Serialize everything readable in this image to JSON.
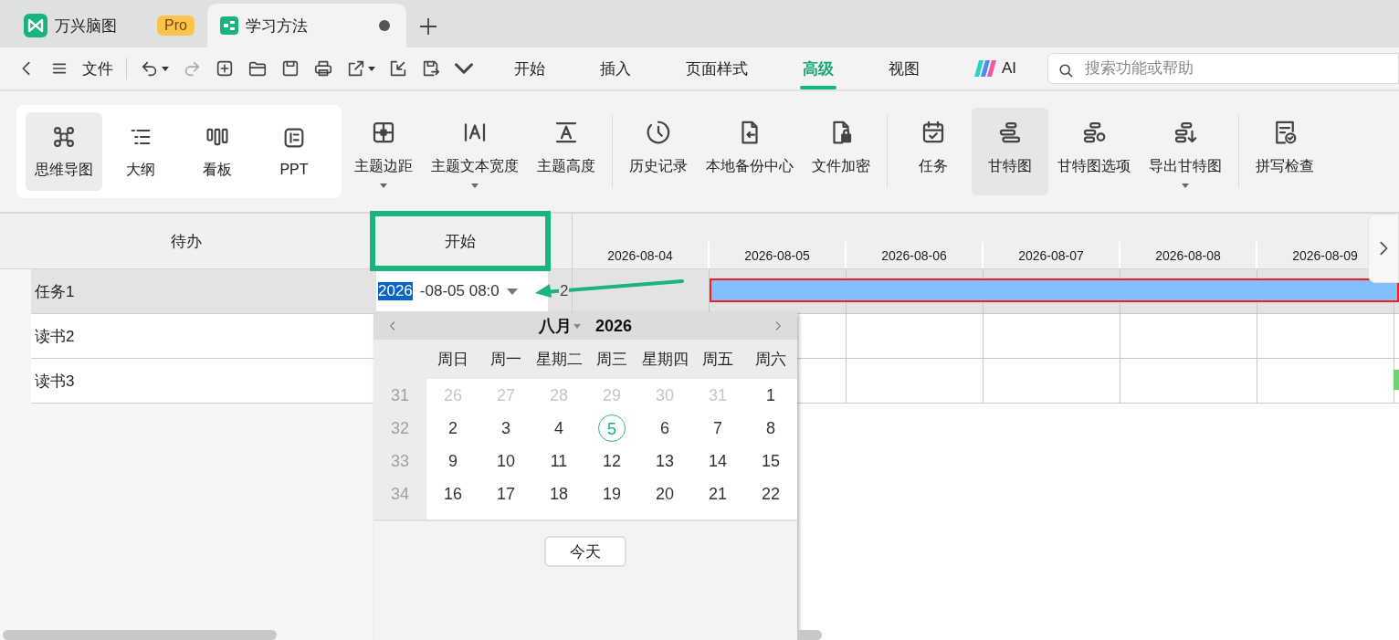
{
  "tabs": [
    {
      "kind": "app",
      "label": "万兴脑图",
      "badge": "Pro",
      "selected": false
    },
    {
      "kind": "document",
      "label": "学习方法",
      "unsaved": true,
      "selected": true
    }
  ],
  "quick_bar": {
    "file_label": "文件",
    "actions": [
      {
        "disabled": false,
        "dropdown": true
      },
      {
        "disabled": true,
        "dropdown": false
      },
      {
        "disabled": false,
        "dropdown": false
      },
      {
        "disabled": false,
        "dropdown": false
      },
      {
        "disabled": false,
        "dropdown": false
      },
      {
        "disabled": false,
        "dropdown": false
      },
      {
        "disabled": false,
        "dropdown": true
      },
      {
        "disabled": false,
        "dropdown": false
      },
      {
        "disabled": false,
        "dropdown": false
      },
      {
        "disabled": false,
        "dropdown": false
      }
    ]
  },
  "menu": [
    {
      "kind": "text",
      "label": "开始",
      "selected": false
    },
    {
      "kind": "text",
      "label": "插入",
      "selected": false
    },
    {
      "kind": "text",
      "label": "页面样式",
      "selected": false
    },
    {
      "kind": "text",
      "label": "高级",
      "selected": true
    },
    {
      "kind": "text",
      "label": "视图",
      "selected": false
    },
    {
      "kind": "ai",
      "label": "AI",
      "selected": false
    }
  ],
  "search": {
    "placeholder": "搜索功能或帮助"
  },
  "view_modes": [
    {
      "label": "思维导图",
      "selected": true
    },
    {
      "label": "大纲",
      "selected": false
    },
    {
      "label": "看板",
      "selected": false
    },
    {
      "label": "PPT",
      "selected": false
    }
  ],
  "ribbon_groups": [
    [
      {
        "label": "主题边距",
        "dropdown": true,
        "selected": false
      },
      {
        "label": "主题文本宽度",
        "dropdown": true,
        "selected": false
      },
      {
        "label": "主题高度",
        "dropdown": false,
        "selected": false
      }
    ],
    [
      {
        "label": "历史记录",
        "dropdown": false,
        "selected": false
      },
      {
        "label": "本地备份中心",
        "dropdown": false,
        "selected": false
      },
      {
        "label": "文件加密",
        "dropdown": false,
        "selected": false
      }
    ],
    [
      {
        "label": "任务",
        "dropdown": false,
        "selected": false
      },
      {
        "label": "甘特图",
        "dropdown": false,
        "selected": true
      },
      {
        "label": "甘特图选项",
        "dropdown": false,
        "selected": false
      },
      {
        "label": "导出甘特图",
        "dropdown": true,
        "selected": false
      }
    ],
    [
      {
        "label": "拼写检查",
        "dropdown": false,
        "selected": false
      }
    ]
  ],
  "gantt": {
    "columns": [
      {
        "label": "待办",
        "highlighted": false
      },
      {
        "label": "开始",
        "highlighted": true
      }
    ],
    "annotation_arrow": true,
    "timeline_dates": [
      "2026-08-04",
      "2026-08-05",
      "2026-08-06",
      "2026-08-07",
      "2026-08-08",
      "2026-08-09"
    ],
    "rows": [
      {
        "name": "任务1",
        "selected": true,
        "start_editor": [
          {
            "text": "2026",
            "selected": true
          },
          {
            "text": "-08-05 08:0",
            "selected": false
          }
        ],
        "column_3": "2",
        "bar": {
          "kind": "span",
          "color": "#80c0ff",
          "outlined": true
        }
      },
      {
        "name": "读书2",
        "selected": false
      },
      {
        "name": "读书3",
        "selected": false,
        "bar": {
          "kind": "edge",
          "color": "#6cd46c",
          "outlined": false
        }
      }
    ]
  },
  "calendar": {
    "month": "八月",
    "year": "2026",
    "weekdays": [
      "周日",
      "周一",
      "星期二",
      "周三",
      "星期四",
      "周五",
      "周六"
    ],
    "weeks": [
      {
        "number": "31",
        "days": [
          {
            "day": "26",
            "outside": true,
            "selected": false
          },
          {
            "day": "27",
            "outside": true,
            "selected": false
          },
          {
            "day": "28",
            "outside": true,
            "selected": false
          },
          {
            "day": "29",
            "outside": true,
            "selected": false
          },
          {
            "day": "30",
            "outside": true,
            "selected": false
          },
          {
            "day": "31",
            "outside": true,
            "selected": false
          },
          {
            "day": "1",
            "outside": false,
            "selected": false
          }
        ]
      },
      {
        "number": "32",
        "days": [
          {
            "day": "2",
            "outside": false,
            "selected": false
          },
          {
            "day": "3",
            "outside": false,
            "selected": false
          },
          {
            "day": "4",
            "outside": false,
            "selected": false
          },
          {
            "day": "5",
            "outside": false,
            "selected": true
          },
          {
            "day": "6",
            "outside": false,
            "selected": false
          },
          {
            "day": "7",
            "outside": false,
            "selected": false
          },
          {
            "day": "8",
            "outside": false,
            "selected": false
          }
        ]
      },
      {
        "number": "33",
        "days": [
          {
            "day": "9",
            "outside": false,
            "selected": false
          },
          {
            "day": "10",
            "outside": false,
            "selected": false
          },
          {
            "day": "11",
            "outside": false,
            "selected": false
          },
          {
            "day": "12",
            "outside": false,
            "selected": false
          },
          {
            "day": "13",
            "outside": false,
            "selected": false
          },
          {
            "day": "14",
            "outside": false,
            "selected": false
          },
          {
            "day": "15",
            "outside": false,
            "selected": false
          }
        ]
      },
      {
        "number": "34",
        "days": [
          {
            "day": "16",
            "outside": false,
            "selected": false
          },
          {
            "day": "17",
            "outside": false,
            "selected": false
          },
          {
            "day": "18",
            "outside": false,
            "selected": false
          },
          {
            "day": "19",
            "outside": false,
            "selected": false
          },
          {
            "day": "20",
            "outside": false,
            "selected": false
          },
          {
            "day": "21",
            "outside": false,
            "selected": false
          },
          {
            "day": "22",
            "outside": false,
            "selected": false
          }
        ]
      }
    ],
    "today_button": "今天"
  }
}
